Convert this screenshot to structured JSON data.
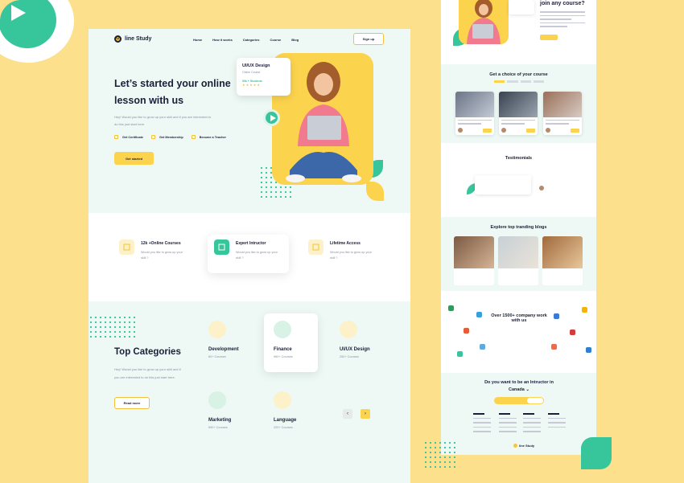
{
  "colors": {
    "background": "#fde08c",
    "accent_yellow": "#fcd34d",
    "accent_green": "#37c59b",
    "mint": "#eef9f5",
    "navy": "#1b1f3a"
  },
  "brand": {
    "logo_letter": "O",
    "logo_text": "line Study"
  },
  "nav": {
    "items": [
      "Home",
      "How it works",
      "Categories",
      "Course",
      "Blog"
    ],
    "signup": "Sign up"
  },
  "hero": {
    "title": "Let’s started your online lesson with us",
    "subtitle": "Hey! Would you like to grow up your skill and if you are interested to do this just start here.",
    "checks": [
      "Get Certificate",
      "Get Membership",
      "Become a Teacher"
    ],
    "cta": "Get started",
    "course_card": {
      "title": "UI/UX Design",
      "type": "Online Course",
      "students": "50k + Students",
      "stars": "★★★★★"
    }
  },
  "features": [
    {
      "title": "12k +Online Courses",
      "text": "Would you like to grow up your skill ?",
      "icon": "book-icon"
    },
    {
      "title": "Expert Intructor",
      "text": "Would you like to grow up your skill ?",
      "icon": "instructor-icon"
    },
    {
      "title": "Lifetime Access",
      "text": "Would you like to grow up your skill ?",
      "icon": "access-icon"
    }
  ],
  "categories": {
    "title": "Top Categories",
    "subtitle": "Hey! Would you like to grow up your skill and if you are interested to do this just start here.",
    "read_more": "Read more",
    "items": [
      {
        "name": "Development",
        "count": "60+ Courses",
        "icon": "code-icon"
      },
      {
        "name": "Finance",
        "count": "960+ Courses",
        "icon": "money-icon"
      },
      {
        "name": "UI/UX Design",
        "count": "250+ Courses",
        "icon": "design-icon"
      },
      {
        "name": "Marketing",
        "count": "590+ Courses",
        "icon": "marketing-icon"
      },
      {
        "name": "Language",
        "count": "220+ Courses",
        "icon": "language-icon"
      }
    ],
    "prev": "‹",
    "next": "›"
  },
  "right_page": {
    "join_title": "join any course?",
    "course_section_title": "Get a choice of your course",
    "testimonials_title": "Testimonials",
    "blogs_title": "Explore top tranding blogs",
    "partners_title": "Over 1500+ company work with us",
    "instructor_title": "Do you want to be an Intructor in Canada ⌄",
    "footer_logo": "line Study"
  }
}
